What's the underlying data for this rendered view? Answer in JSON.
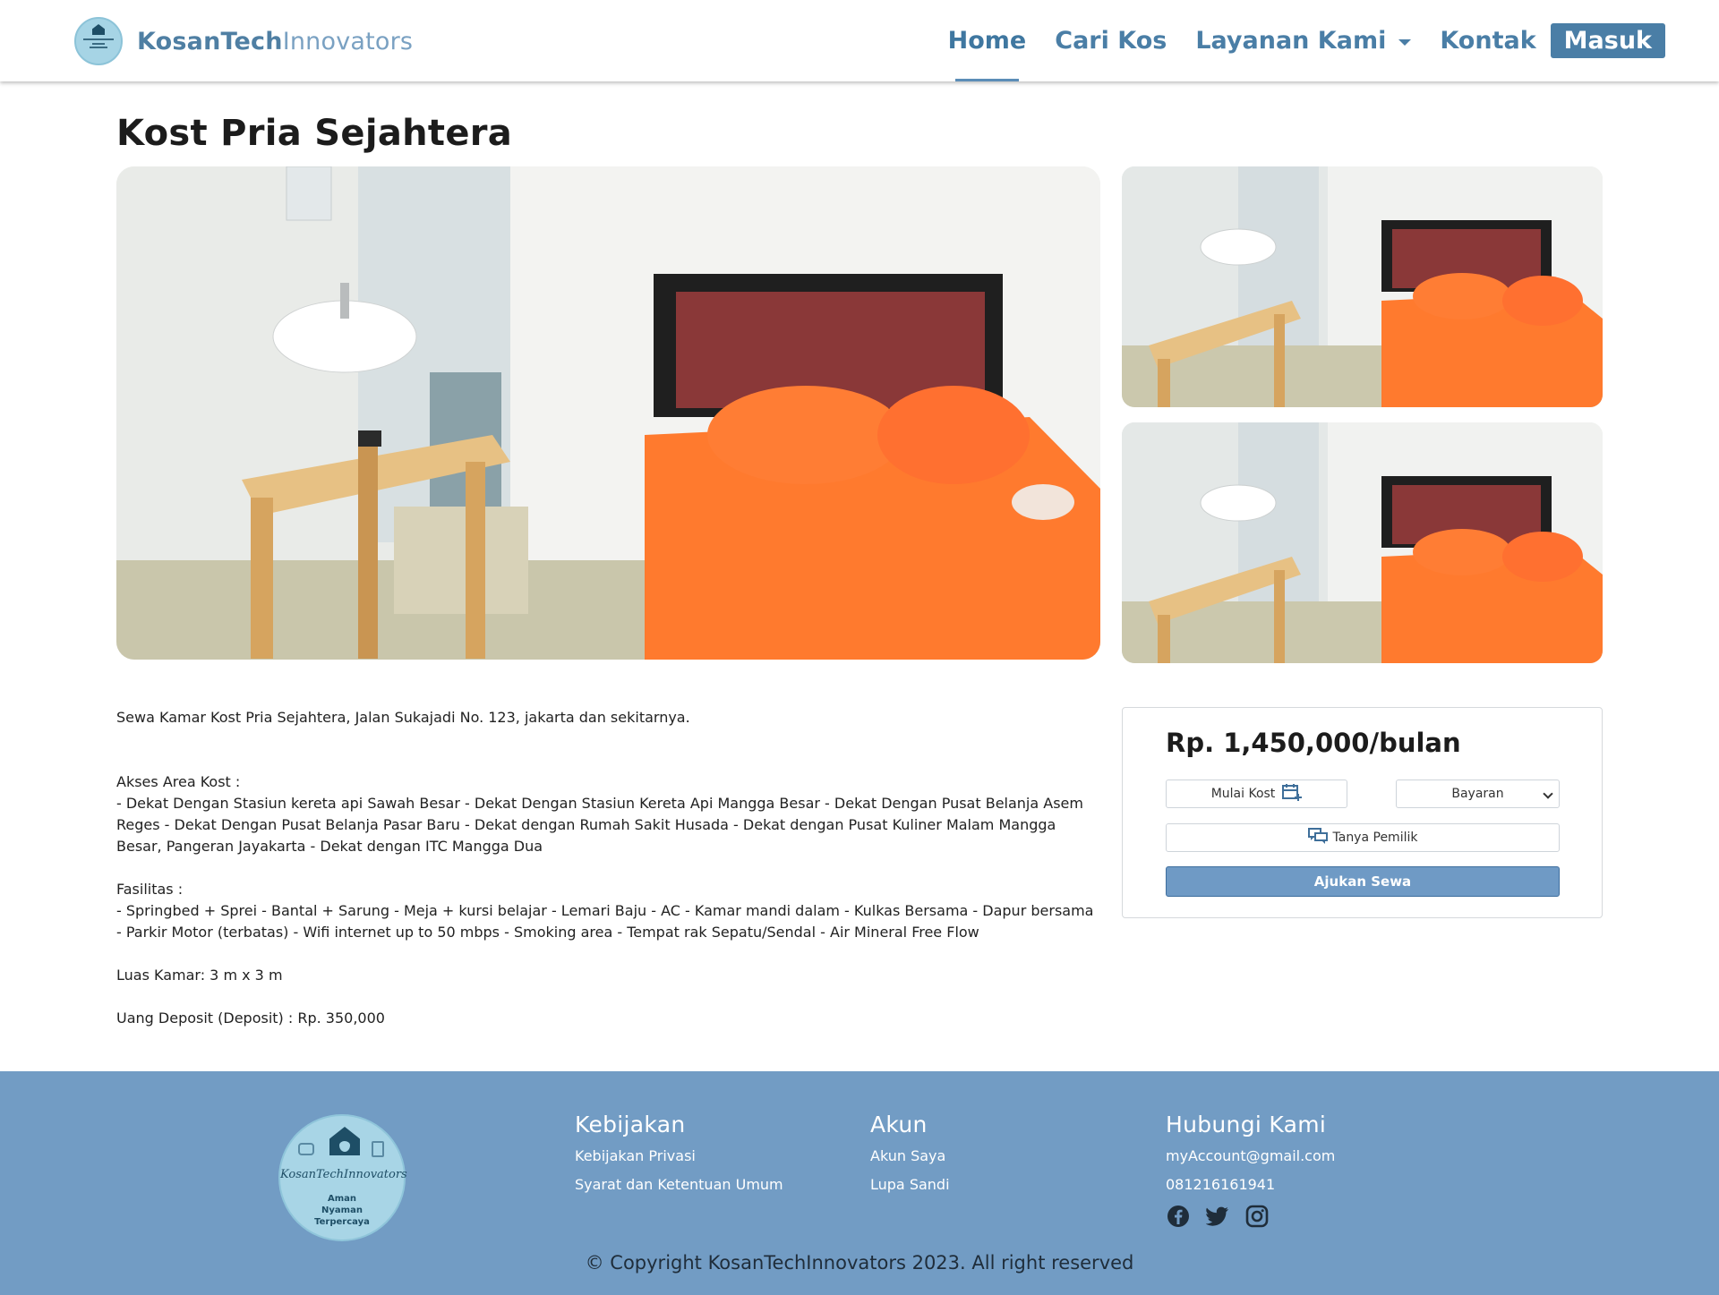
{
  "brand": {
    "name_part1": "KosanTech",
    "name_part2": "Innovators"
  },
  "nav": {
    "home": "Home",
    "cari_kos": "Cari Kos",
    "layanan": "Layanan Kami",
    "kontak": "Kontak",
    "masuk": "Masuk"
  },
  "listing": {
    "title": "Kost Pria Sejahtera",
    "intro": "Sewa Kamar Kost Pria Sejahtera, Jalan Sukajadi No. 123, jakarta dan sekitarnya.",
    "akses_label": "Akses Area Kost :",
    "akses_text": "- Dekat Dengan Stasiun kereta api Sawah Besar - Dekat Dengan Stasiun Kereta Api Mangga Besar - Dekat Dengan Pusat Belanja Asem Reges - Dekat Dengan Pusat Belanja Pasar Baru - Dekat dengan Rumah Sakit Husada - Dekat dengan Pusat Kuliner Malam Mangga Besar, Pangeran Jayakarta - Dekat dengan ITC Mangga Dua",
    "fasilitas_label": "Fasilitas :",
    "fasilitas_text": "- Springbed + Sprei - Bantal + Sarung - Meja + kursi belajar - Lemari Baju - AC - Kamar mandi dalam - Kulkas Bersama - Dapur bersama - Parkir Motor (terbatas) - Wifi internet up to 50 mbps - Smoking area - Tempat rak Sepatu/Sendal - Air Mineral Free Flow",
    "luas": "Luas Kamar: 3 m x 3 m",
    "deposit": "Uang Deposit (Deposit) : Rp. 350,000"
  },
  "booking": {
    "price": "Rp. 1,450,000/bulan",
    "mulai_kost": "Mulai Kost",
    "bayaran": "Bayaran",
    "tanya": "Tanya Pemilik",
    "ajukan": "Ajukan Sewa"
  },
  "footer": {
    "logo_name": "KosanTechInnovators",
    "logo_tag1": "Aman",
    "logo_tag2": "Nyaman",
    "logo_tag3": "Terpercaya",
    "kebijakan_title": "Kebijakan",
    "kebijakan_links": [
      "Kebijakan Privasi",
      "Syarat dan Ketentuan Umum"
    ],
    "akun_title": "Akun",
    "akun_links": [
      "Akun Saya",
      "Lupa Sandi"
    ],
    "hubungi_title": "Hubungi Kami",
    "email": "myAccount@gmail.com",
    "phone": "081216161941",
    "copyright": "© Copyright KosanTechInnovators 2023. All right reserved"
  },
  "icons": [
    "facebook-icon",
    "twitter-icon",
    "instagram-icon",
    "calendar-plus-icon",
    "chat-icon",
    "chevron-down-icon"
  ],
  "colors": {
    "primary": "#4a7ea6",
    "footer_bg": "#729cc4",
    "button_bg": "#6f9ac5"
  }
}
